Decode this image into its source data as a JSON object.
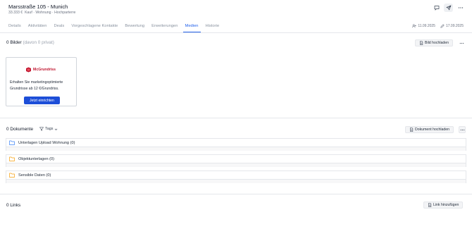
{
  "header": {
    "title": "Marsstraße 105 - Munich",
    "price": "33.333 €",
    "details": "Kauf · Wohnung · Hochparterre",
    "icons": [
      "chat-icon",
      "send-icon",
      "more-icon"
    ]
  },
  "tabs": [
    {
      "label": "Details",
      "active": false
    },
    {
      "label": "Aktivitäten",
      "active": false
    },
    {
      "label": "Deals",
      "active": false
    },
    {
      "label": "Vorgeschlagene Kontakte",
      "active": false
    },
    {
      "label": "Bewertung",
      "active": false
    },
    {
      "label": "Erweiterungen",
      "active": false
    },
    {
      "label": "Medien",
      "active": true
    },
    {
      "label": "Historie",
      "active": false
    }
  ],
  "dates": {
    "created": "11.09.2025",
    "updated": "17.09.2025"
  },
  "images": {
    "title": "0 Bilder",
    "private_note": "(davon 0 privat)",
    "upload_label": "Bild hochladen"
  },
  "promo": {
    "brand": "McGrundriss",
    "text": "Erhalten Sie marketingoptimierte Grundrisse ab 12 €/Grundriss.",
    "cta_label": "Jetzt einrichten"
  },
  "documents": {
    "title": "0 Dokumente",
    "tags_label": "Tags",
    "upload_label": "Dokument hochladen",
    "folders": [
      {
        "label": "Unterlagen Upload Wohnung (0)",
        "color": "#3b82f6"
      },
      {
        "label": "Objektunterlagen (0)",
        "color": "#f59e0b"
      },
      {
        "label": "Sensible Daten (0)",
        "color": "#f59e0b"
      }
    ]
  },
  "links": {
    "title": "0 Links",
    "add_label": "Link hinzufügen"
  },
  "colors": {
    "accent": "#2563eb",
    "cta": "#1d4ed8",
    "brand_red": "#c0152f"
  }
}
